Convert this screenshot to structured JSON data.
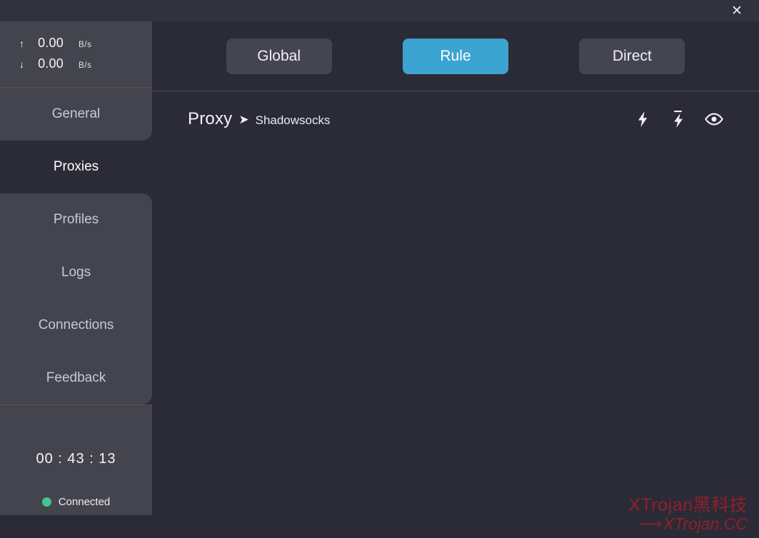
{
  "window": {
    "close_label": "✕"
  },
  "sidebar": {
    "traffic": {
      "upload": {
        "arrow": "↑",
        "value": "0.00",
        "unit": "B/s"
      },
      "download": {
        "arrow": "↓",
        "value": "0.00",
        "unit": "B/s"
      }
    },
    "nav": [
      {
        "label": "General",
        "active": false
      },
      {
        "label": "Proxies",
        "active": true
      },
      {
        "label": "Profiles",
        "active": false
      },
      {
        "label": "Logs",
        "active": false
      },
      {
        "label": "Connections",
        "active": false
      },
      {
        "label": "Feedback",
        "active": false
      }
    ],
    "status": {
      "timer": "00 : 43 : 13",
      "connection_label": "Connected",
      "connection_color": "#41c78c"
    }
  },
  "main": {
    "modes": [
      {
        "label": "Global",
        "selected": false
      },
      {
        "label": "Rule",
        "selected": true
      },
      {
        "label": "Direct",
        "selected": false
      }
    ],
    "mode_selected_color": "#3ba4d0",
    "breadcrumb": {
      "primary": "Proxy",
      "separator": "➤",
      "secondary": "Shadowsocks"
    },
    "actions": [
      {
        "name": "speed-test-all-icon",
        "title": "Test all latency"
      },
      {
        "name": "speed-test-single-icon",
        "title": "Test selected latency"
      },
      {
        "name": "eye-icon",
        "title": "Toggle visibility"
      }
    ]
  },
  "watermark": {
    "line1": "XTrojan黑科技",
    "arrow": "⟶",
    "line2": "XTrojan.CC",
    "color": "#8e2128"
  }
}
